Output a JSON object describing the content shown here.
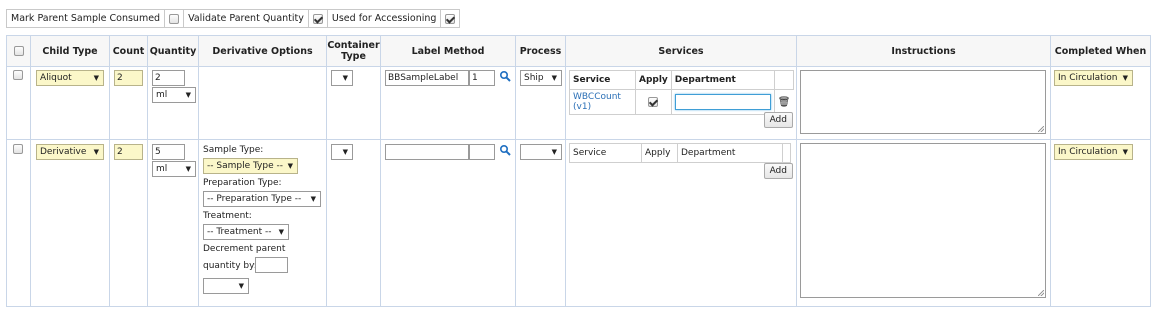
{
  "options": [
    {
      "label": "Mark Parent Sample Consumed",
      "checked": false
    },
    {
      "label": "Validate Parent Quantity",
      "checked": true
    },
    {
      "label": "Used for Accessioning",
      "checked": true
    }
  ],
  "columns": [
    "Child Type",
    "Count",
    "Quantity",
    "Derivative Options",
    "Container Type",
    "Label Method",
    "Process",
    "Services",
    "Instructions",
    "Completed When"
  ],
  "rows": [
    {
      "child_type": "Aliquot",
      "count": "2",
      "quantity": "2",
      "unit": "ml",
      "label_method": "BBSampleLabel",
      "label_count": "1",
      "process": "Ship",
      "services_headers": [
        "Service",
        "Apply",
        "Department"
      ],
      "service_name": "WBCCount (v1)",
      "add_label": "Add",
      "completed_when": "In Circulation"
    },
    {
      "child_type": "Derivative",
      "count": "2",
      "quantity": "5",
      "unit": "ml",
      "sample_type_label": "Sample Type:",
      "sample_type_value": "-- Sample Type --",
      "prep_type_label": "Preparation Type:",
      "prep_type_value": "-- Preparation Type --",
      "treatment_label": "Treatment:",
      "treatment_value": "-- Treatment --",
      "decrement_label1": "Decrement parent",
      "decrement_label2": "quantity by:",
      "services_headers": [
        "Service",
        "Apply",
        "Department"
      ],
      "add_label": "Add",
      "completed_when": "In Circulation"
    }
  ]
}
